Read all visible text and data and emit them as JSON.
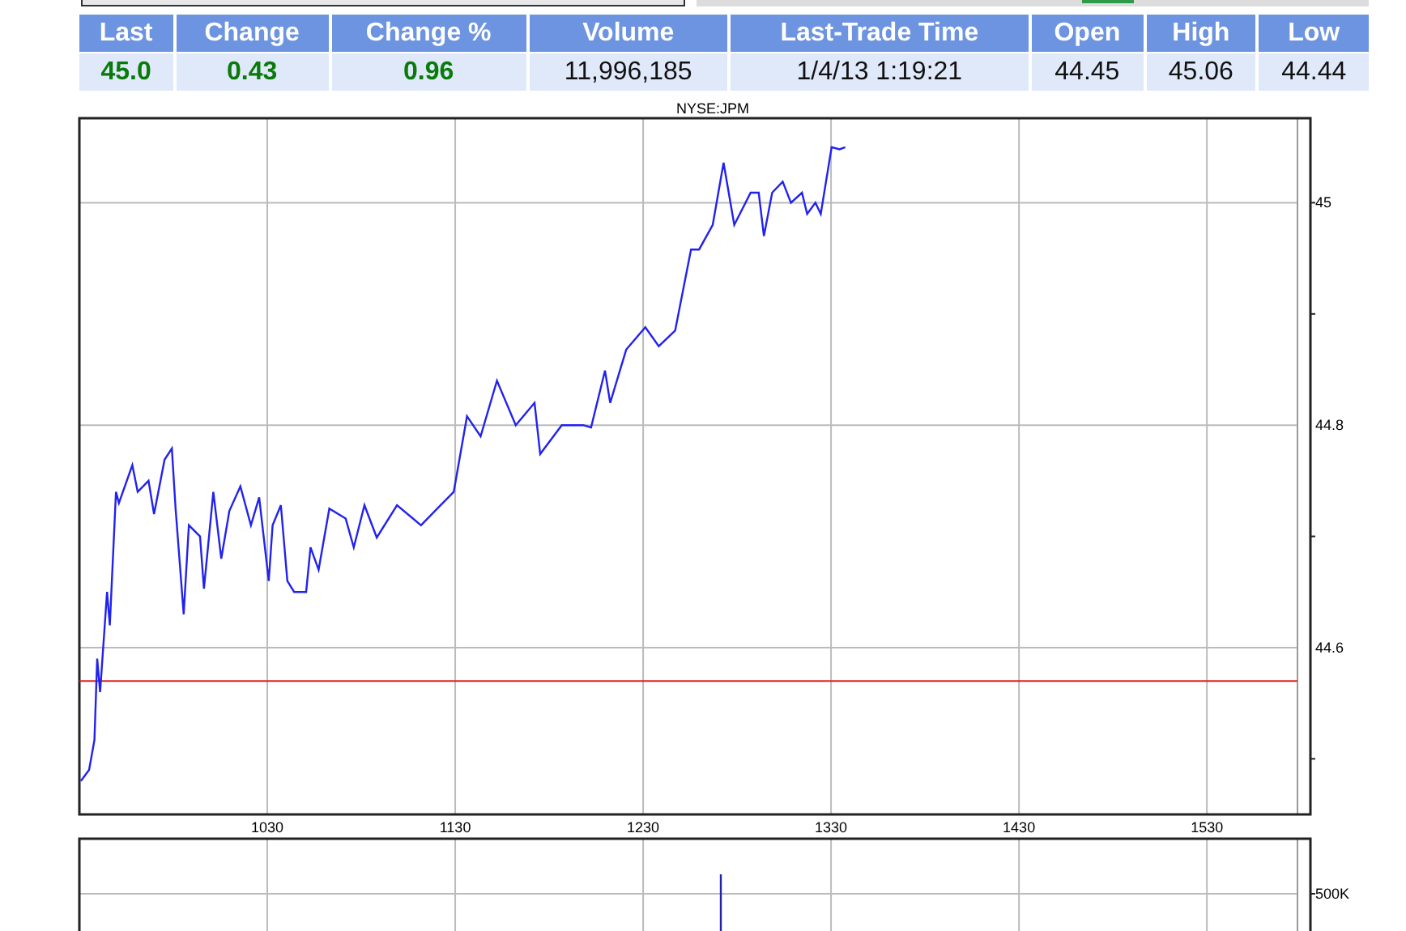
{
  "quote_table": {
    "columns": [
      "Last",
      "Change",
      "Change %",
      "Volume",
      "Last-Trade Time",
      "Open",
      "High",
      "Low"
    ],
    "row": [
      {
        "text": "45.0",
        "kind": "gain"
      },
      {
        "text": "0.43",
        "kind": "gain"
      },
      {
        "text": "0.96",
        "kind": "gain"
      },
      {
        "text": "11,996,185",
        "kind": "plain"
      },
      {
        "text": "1/4/13 1:19:21",
        "kind": "plain"
      },
      {
        "text": "44.45",
        "kind": "plain"
      },
      {
        "text": "45.06",
        "kind": "plain"
      },
      {
        "text": "44.44",
        "kind": "plain"
      }
    ]
  },
  "price_chart": {
    "chart_data": {
      "type": "line",
      "title": "NYSE:JPM",
      "x": [
        930.8,
        935.2,
        938.0,
        939.5,
        941.0,
        944.7,
        946.2,
        949.5,
        951.0,
        958.2,
        961.0,
        966.8,
        969.7,
        975.3,
        979.2,
        981.2,
        985.5,
        988.3,
        994.2,
        996.3,
        1001.3,
        1005.5,
        1009.8,
        1015.7,
        1021.3,
        1025.7,
        1030.8,
        1032.8,
        1037.2,
        1040.7,
        1044.3,
        1050.7,
        1053.0,
        1057.3,
        1063.0,
        1071.7,
        1076.0,
        1081.7,
        1088.3,
        1099.0,
        1111.8,
        1120.5,
        1129.2,
        1136.3,
        1143.5,
        1152.2,
        1162.2,
        1172.2,
        1175.2,
        1186.7,
        1198.2,
        1202.3,
        1209.7,
        1212.5,
        1221.0,
        1231.2,
        1238.3,
        1247.0,
        1255.5,
        1259.8,
        1267.0,
        1272.8,
        1278.5,
        1287.2,
        1291.5,
        1294.3,
        1298.7,
        1304.3,
        1308.7,
        1314.5,
        1317.3,
        1321.7,
        1324.5,
        1330.3,
        1334.5,
        1337.5
      ],
      "series": [
        {
          "color": "#2222ee",
          "values": [
            44.48,
            44.49,
            44.517,
            44.59,
            44.56,
            44.65,
            44.62,
            44.74,
            44.73,
            44.764,
            44.74,
            44.75,
            44.72,
            44.769,
            44.779,
            44.725,
            44.63,
            44.71,
            44.7,
            44.653,
            44.74,
            44.68,
            44.723,
            44.745,
            44.71,
            44.735,
            44.66,
            44.71,
            44.728,
            44.66,
            44.65,
            44.65,
            44.69,
            44.67,
            44.725,
            44.716,
            44.69,
            44.728,
            44.699,
            44.728,
            44.71,
            44.725,
            44.74,
            44.808,
            44.79,
            44.84,
            44.8,
            44.82,
            44.774,
            44.8,
            44.8,
            44.798,
            44.849,
            44.82,
            44.868,
            44.888,
            44.871,
            44.885,
            44.958,
            44.958,
            44.98,
            45.036,
            44.98,
            45.009,
            45.009,
            44.97,
            45.009,
            45.019,
            45.0,
            45.009,
            44.99,
            45.0,
            44.99,
            45.05,
            45.048,
            45.05
          ]
        }
      ],
      "xlim": [
        930,
        1578.2
      ],
      "ylim": [
        44.45,
        45.076
      ],
      "xticks": [
        1030,
        1130,
        1230,
        1330,
        1430,
        1530
      ],
      "yticks": [
        44.6,
        44.8,
        45
      ],
      "grid": true,
      "ref_lines": [
        {
          "axis": "y",
          "value": 44.57,
          "color": "#dd2222"
        }
      ]
    }
  },
  "volume_chart": {
    "ytick_label": "500K"
  }
}
